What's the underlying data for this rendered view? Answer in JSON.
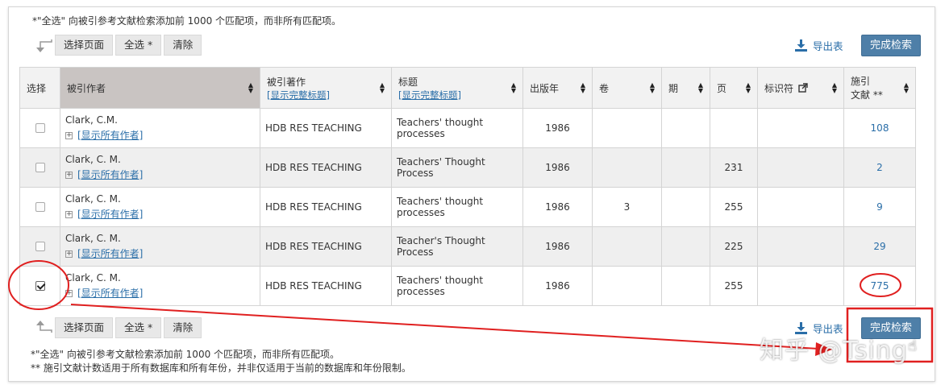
{
  "notes": {
    "top": "*\"全选\" 向被引参考文献检索添加前 1000 个匹配项，而非所有匹配项。",
    "bottom_1": "*\"全选\" 向被引参考文献检索添加前 1000 个匹配项，而非所有匹配项。",
    "bottom_2": "** 施引文献计数适用于所有数据库和所有年份，并非仅适用于当前的数据库和年份限制。"
  },
  "toolbar": {
    "select_page": "选择页面",
    "select_all": "全选 *",
    "clear": "清除",
    "export": "导出表",
    "finish": "完成检索"
  },
  "table": {
    "headers": {
      "select": "选择",
      "cited_author": "被引作者",
      "cited_work": "被引著作",
      "cited_work_sub": "[显示完整标题]",
      "title": "标题",
      "title_sub": "[显示完整标题]",
      "year": "出版年",
      "volume": "卷",
      "issue": "期",
      "page": "页",
      "identifier": "标识符",
      "citing_1": "施引",
      "citing_2": "文献 **"
    },
    "show_all_authors": "[显示所有作者]",
    "rows": [
      {
        "author": "Clark, C.M.",
        "work": "HDB RES TEACHING",
        "title": "Teachers' thought processes",
        "year": "1986",
        "volume": "",
        "issue": "",
        "page": "",
        "identifier": "",
        "citing": "108",
        "checked": false
      },
      {
        "author": "Clark, C. M.",
        "work": "HDB RES TEACHING",
        "title": "Teachers' Thought Process",
        "year": "1986",
        "volume": "",
        "issue": "",
        "page": "231",
        "identifier": "",
        "citing": "2",
        "checked": false
      },
      {
        "author": "Clark, C. M.",
        "work": "HDB RES TEACHING",
        "title": "Teachers' thought processes",
        "year": "1986",
        "volume": "3",
        "issue": "",
        "page": "255",
        "identifier": "",
        "citing": "9",
        "checked": false
      },
      {
        "author": "Clark, C. M.",
        "work": "HDB RES TEACHING",
        "title": "Teacher's Thought Process",
        "year": "1986",
        "volume": "",
        "issue": "",
        "page": "225",
        "identifier": "",
        "citing": "29",
        "checked": false
      },
      {
        "author": "Clark, C. M.",
        "work": "HDB RES TEACHING",
        "title": "Teachers' thought processes",
        "year": "1986",
        "volume": "",
        "issue": "",
        "page": "255",
        "identifier": "",
        "citing": "775",
        "checked": true
      }
    ]
  },
  "watermark": "知乎 @Tsing",
  "colors": {
    "accent": "#2a6ea8",
    "button": "#4e7fa8",
    "annotation": "#e02020"
  }
}
